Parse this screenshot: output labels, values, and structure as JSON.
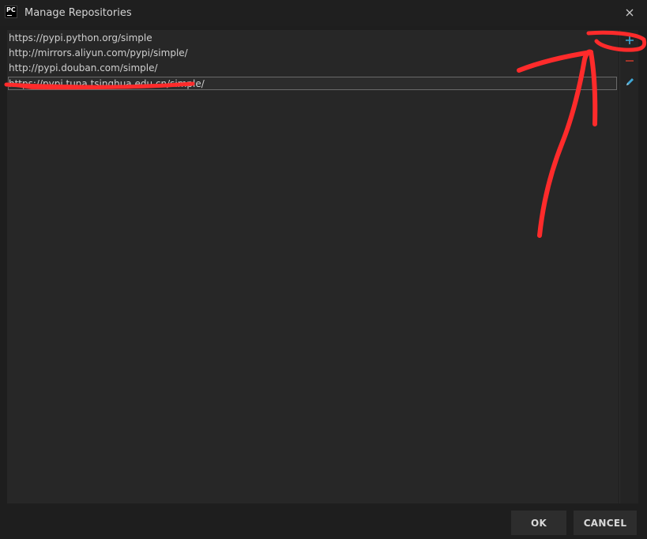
{
  "window": {
    "title": "Manage Repositories",
    "app_icon_text": "PC"
  },
  "repositories": [
    "https://pypi.python.org/simple",
    "http://mirrors.aliyun.com/pypi/simple/",
    "http://pypi.douban.com/simple/",
    "https://pypi.tuna.tsinghua.edu.cn/simple/"
  ],
  "toolbar": {
    "add_icon": "plus-icon",
    "remove_icon": "minus-icon",
    "edit_icon": "pencil-icon"
  },
  "buttons": {
    "ok_label": "OK",
    "cancel_label": "CANCEL"
  },
  "colors": {
    "add": "#3fa7d6",
    "remove": "#c0392b",
    "edit": "#3fa7d6",
    "annotation": "#ff2b2b"
  }
}
